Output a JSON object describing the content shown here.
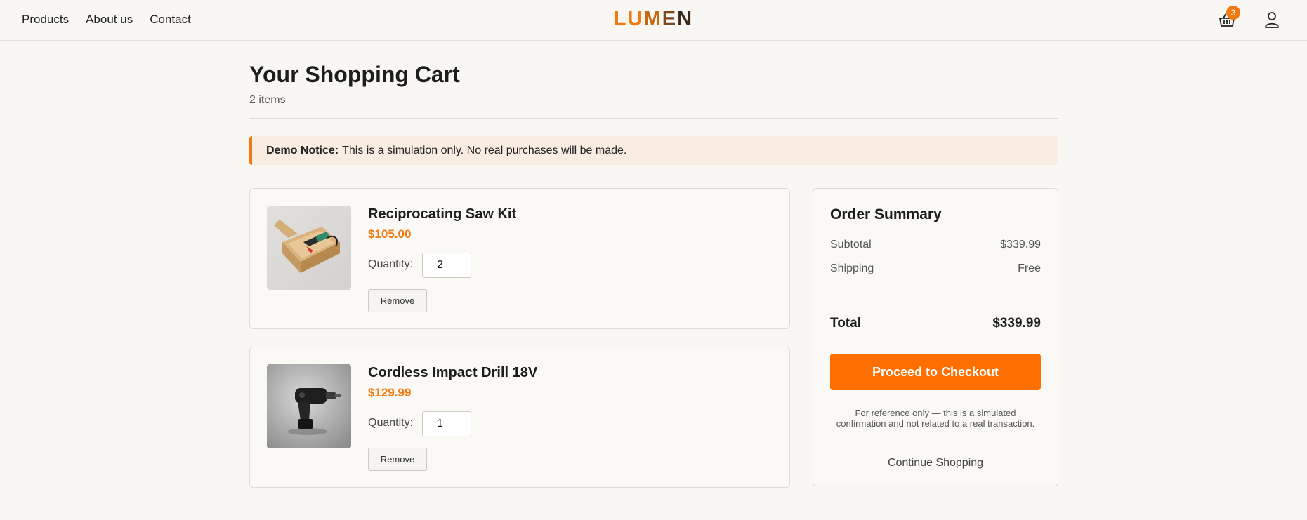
{
  "header": {
    "nav": [
      "Products",
      "About us",
      "Contact"
    ],
    "logo": [
      "L",
      "U",
      "M",
      "E",
      "N"
    ],
    "cart_count": "3"
  },
  "cart": {
    "title": "Your Shopping Cart",
    "count_label": "2 items"
  },
  "notice": {
    "label": "Demo Notice:",
    "text": "This is a simulation only. No real purchases will be made."
  },
  "items": [
    {
      "name": "Reciprocating Saw Kit",
      "price": "$105.00",
      "quantity_label": "Quantity:",
      "quantity": "2",
      "remove_label": "Remove",
      "image_icon": "tool-kit-photo"
    },
    {
      "name": "Cordless Impact Drill 18V",
      "price": "$129.99",
      "quantity_label": "Quantity:",
      "quantity": "1",
      "remove_label": "Remove",
      "image_icon": "drill-photo"
    }
  ],
  "summary": {
    "title": "Order Summary",
    "subtotal_label": "Subtotal",
    "subtotal": "$339.99",
    "shipping_label": "Shipping",
    "shipping": "Free",
    "total_label": "Total",
    "total": "$339.99",
    "checkout_label": "Proceed to Checkout",
    "disclaimer": "For reference only — this is a simulated confirmation and not related to a real transaction.",
    "continue_label": "Continue Shopping"
  },
  "colors": {
    "accent": "#f27a0e",
    "button": "#ff6f00",
    "background": "#f9f7f3"
  }
}
